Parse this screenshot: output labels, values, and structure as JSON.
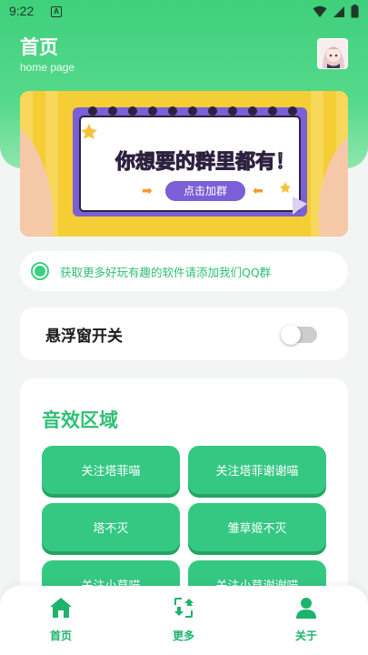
{
  "status_bar": {
    "time": "9:22",
    "notification_letter": "A"
  },
  "header": {
    "title": "首页",
    "subtitle": "home page"
  },
  "banner": {
    "headline": "你想要的群里都有！",
    "button_label": "点击加群"
  },
  "notice": {
    "text": "获取更多好玩有趣的软件请添加我们QQ群"
  },
  "float_window": {
    "label": "悬浮窗开关",
    "enabled": false
  },
  "sound_section": {
    "title": "音效区域",
    "buttons": [
      {
        "label": "关注塔菲喵"
      },
      {
        "label": "关注塔菲谢谢喵"
      },
      {
        "label": "塔不灭"
      },
      {
        "label": "雏草姬不灭"
      },
      {
        "label": "关注小草喵"
      },
      {
        "label": "关注小草谢谢喵"
      }
    ]
  },
  "tabbar": {
    "tabs": [
      {
        "label": "首页",
        "icon": "home-icon"
      },
      {
        "label": "更多",
        "icon": "more-icon"
      },
      {
        "label": "关于",
        "icon": "user-icon"
      }
    ]
  },
  "colors": {
    "accent": "#35c883",
    "accent_dark": "#22a563",
    "header_green": "#3fd07c",
    "notice_text": "#2fc074"
  }
}
